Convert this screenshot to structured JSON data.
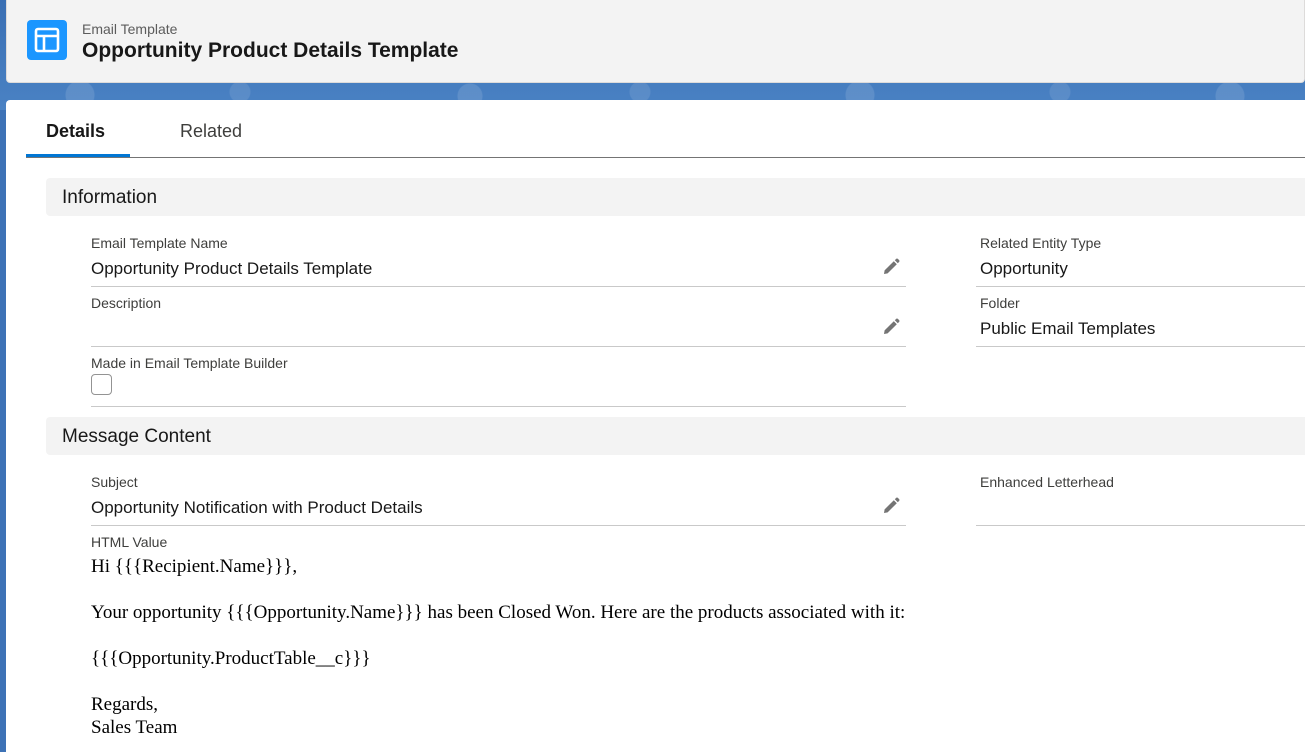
{
  "header": {
    "object_type": "Email Template",
    "title": "Opportunity Product Details Template",
    "icon": "email-template-icon",
    "icon_color": "#1b96ff"
  },
  "tabs": [
    {
      "label": "Details",
      "active": true
    },
    {
      "label": "Related",
      "active": false
    }
  ],
  "sections": {
    "information": {
      "title": "Information",
      "email_template_name": {
        "label": "Email Template Name",
        "value": "Opportunity Product Details Template"
      },
      "description": {
        "label": "Description",
        "value": ""
      },
      "made_in_builder": {
        "label": "Made in Email Template Builder",
        "checked": false
      },
      "related_entity_type": {
        "label": "Related Entity Type",
        "value": "Opportunity"
      },
      "folder": {
        "label": "Folder",
        "value": "Public Email Templates"
      }
    },
    "message_content": {
      "title": "Message Content",
      "subject": {
        "label": "Subject",
        "value": "Opportunity Notification with Product Details"
      },
      "enhanced_letterhead": {
        "label": "Enhanced Letterhead",
        "value": ""
      },
      "html_value": {
        "label": "HTML Value",
        "lines": [
          "Hi {{{Recipient.Name}}},",
          "Your opportunity {{{Opportunity.Name}}} has been Closed Won. Here are the products associated with it:",
          "{{{Opportunity.ProductTable__c}}}",
          "Regards,",
          "Sales Team"
        ]
      }
    }
  },
  "colors": {
    "accent": "#0176d3",
    "background": "#3d72b6"
  }
}
